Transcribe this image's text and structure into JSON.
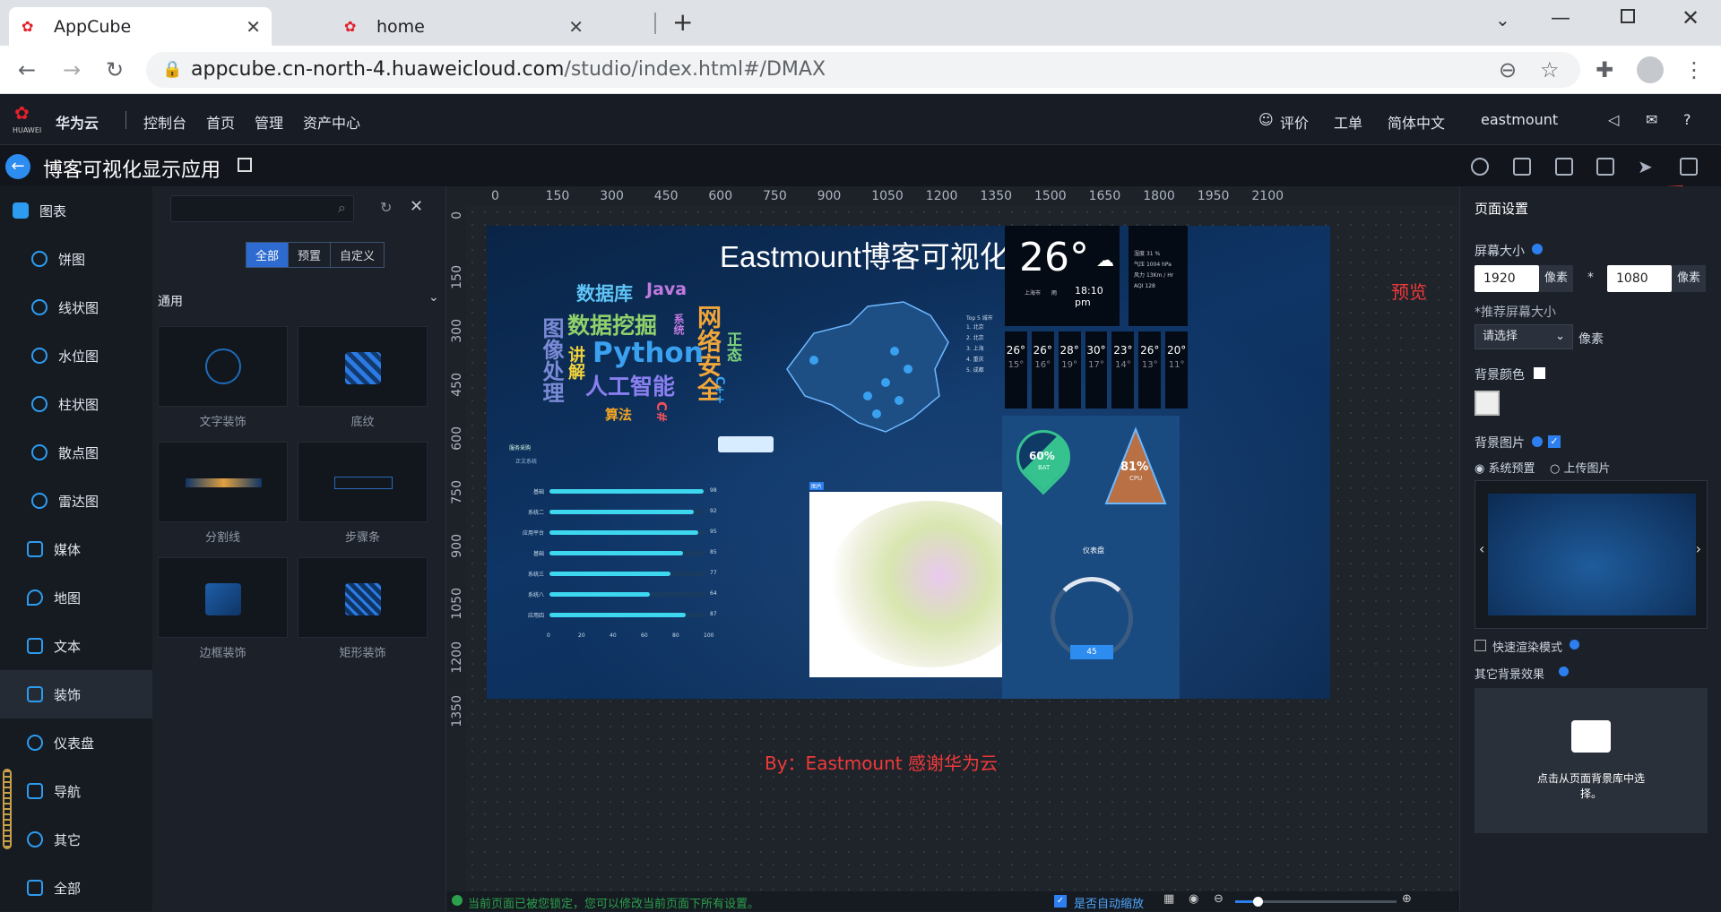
{
  "browser": {
    "tabs": [
      {
        "title": "AppCube",
        "active": true
      },
      {
        "title": "home",
        "active": false
      }
    ],
    "url_host": "appcube.cn-north-4.huaweicloud.com",
    "url_path": "/studio/index.html#/DMAX"
  },
  "header": {
    "brand_small": "HUAWEI",
    "brand": "华为云",
    "nav": [
      "控制台",
      "首页",
      "管理",
      "资产中心"
    ],
    "feedback": "评价",
    "ticket": "工单",
    "language": "简体中文",
    "user": "eastmount"
  },
  "project": {
    "title": "博客可视化显示应用"
  },
  "sidebar": {
    "items": [
      {
        "label": "图表",
        "level": 0
      },
      {
        "label": "饼图",
        "level": 1
      },
      {
        "label": "线状图",
        "level": 1
      },
      {
        "label": "水位图",
        "level": 1
      },
      {
        "label": "柱状图",
        "level": 1
      },
      {
        "label": "散点图",
        "level": 1
      },
      {
        "label": "雷达图",
        "level": 1
      },
      {
        "label": "媒体",
        "level": 0
      },
      {
        "label": "地图",
        "level": 0
      },
      {
        "label": "文本",
        "level": 0
      },
      {
        "label": "装饰",
        "level": 0,
        "selected": true
      },
      {
        "label": "仪表盘",
        "level": 0
      },
      {
        "label": "导航",
        "level": 0
      },
      {
        "label": "其它",
        "level": 0
      },
      {
        "label": "全部",
        "level": 0
      }
    ]
  },
  "components": {
    "filters": [
      "全部",
      "预置",
      "自定义"
    ],
    "active_filter": "全部",
    "section": "通用",
    "items": [
      "文字装饰",
      "底纹",
      "分割线",
      "步骤条",
      "边框装饰",
      "矩形装饰"
    ]
  },
  "ruler": {
    "h": [
      "0",
      "150",
      "300",
      "450",
      "600",
      "750",
      "900",
      "1050",
      "1200",
      "1350",
      "1500",
      "1650",
      "1800",
      "1950",
      "2100"
    ],
    "v": [
      "0",
      "150",
      "300",
      "450",
      "600",
      "750",
      "900",
      "1050",
      "1200",
      "1350"
    ]
  },
  "dashboard": {
    "title": "Eastmount博客可视化应用",
    "wordcloud": [
      {
        "t": "数据库",
        "c": "#5dc4f5"
      },
      {
        "t": "Java",
        "c": "#c07ae0"
      },
      {
        "t": "数据挖掘",
        "c": "#8fd16a"
      },
      {
        "t": "系统",
        "c": "#c07ae0"
      },
      {
        "t": "网络安全",
        "c": "#f0a63a"
      },
      {
        "t": "Python",
        "c": "#3aa0f0"
      },
      {
        "t": "人工智能",
        "c": "#8a7ff0"
      },
      {
        "t": "算法",
        "c": "#f5a623"
      },
      {
        "t": "C#",
        "c": "#f04f5e"
      },
      {
        "t": "C++",
        "c": "#3aa0f0"
      },
      {
        "t": "图像处理",
        "c": "#7a8ad6"
      },
      {
        "t": "讲解",
        "c": "#f0d23a"
      },
      {
        "t": "正态",
        "c": "#7dd37d"
      }
    ],
    "weather": {
      "temp": "26°",
      "city": "上海市",
      "condition": "雨",
      "time": "18:10 pm",
      "stats": [
        [
          "湿度",
          "31 %"
        ],
        [
          "气压",
          "1004 hPa"
        ],
        [
          "风力",
          "13Km / Hr"
        ],
        [
          "AQI",
          "128"
        ]
      ],
      "forecast": [
        "26°",
        "26°",
        "28°",
        "30°",
        "23°",
        "26°",
        "20°"
      ],
      "forecast_low": [
        "15°",
        "16°",
        "19°",
        "17°",
        "14°",
        "13°",
        "11°"
      ]
    },
    "bar_title": "服务采购",
    "bar_legend": "正文系统",
    "bars": [
      {
        "label": "基础",
        "v": 98
      },
      {
        "label": "系统二",
        "v": 92
      },
      {
        "label": "应用平台",
        "v": 95
      },
      {
        "label": "基础",
        "v": 85
      },
      {
        "label": "系统三",
        "v": 77
      },
      {
        "label": "系统八",
        "v": 64
      },
      {
        "label": "应用四",
        "v": 87
      }
    ],
    "bar_axis": [
      "0",
      "20",
      "40",
      "60",
      "80",
      "100"
    ],
    "graph_label": "图片",
    "gauge1": {
      "value": "60%",
      "label": "BAT"
    },
    "gauge2": {
      "value": "81%",
      "label": "CPU"
    },
    "dial_title": "仪表盘",
    "dial_value": "45",
    "top5_title": "Top 5 城市",
    "top5": [
      "1. 北京",
      "2. 北京",
      "3. 上海",
      "4. 重庆",
      "5. 成都"
    ]
  },
  "canvas_note": "By：Eastmount 感谢华为云",
  "annotation_preview": "预览",
  "right_panel": {
    "title": "页面设置",
    "screen_size_label": "屏幕大小",
    "width": "1920",
    "height": "1080",
    "unit": "像素",
    "recommend_label": "*推荐屏幕大小",
    "select_placeholder": "请选择",
    "bg_color_label": "背景颜色",
    "bg_image_label": "背景图片",
    "radio_system": "系统预置",
    "radio_upload": "上传图片",
    "fast_render": "快速渲染模式",
    "other_effects": "其它背景效果",
    "upload_text": "点击从页面背景库中选择。"
  },
  "statusbar": {
    "lock_msg": "当前页面已被您锁定，您可以修改当前页面下所有设置。",
    "auto_zoom": "是否自动缩放"
  },
  "colors": {
    "accent": "#2d7ff0",
    "annotation": "#f03a3a",
    "dashboard_bg": "#0e3566"
  }
}
